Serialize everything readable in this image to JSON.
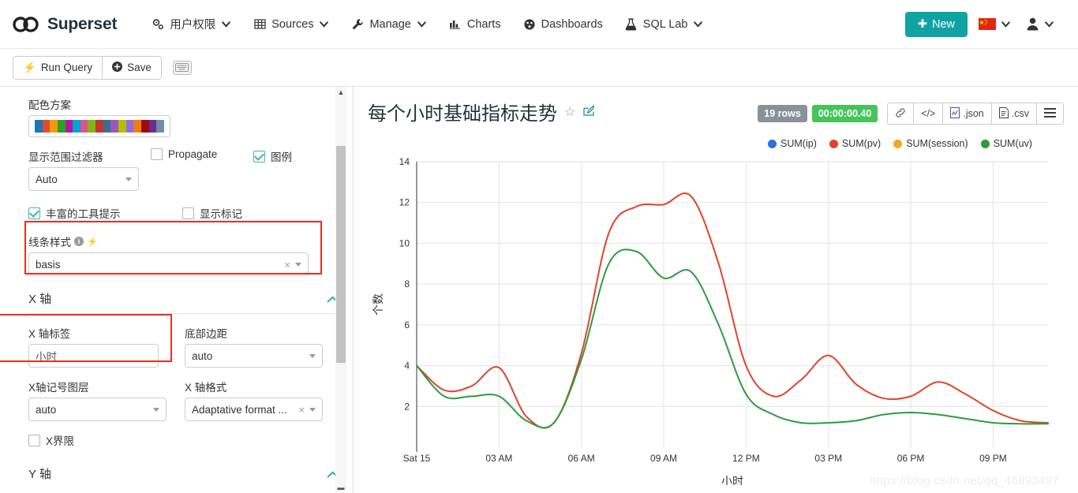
{
  "navbar": {
    "brand": "Superset",
    "items": [
      {
        "label": "用户权限",
        "icon": "gears-icon",
        "caret": true
      },
      {
        "label": "Sources",
        "icon": "table-icon",
        "caret": true
      },
      {
        "label": "Manage",
        "icon": "wrench-icon",
        "caret": true
      },
      {
        "label": "Charts",
        "icon": "bar-chart-icon",
        "caret": false
      },
      {
        "label": "Dashboards",
        "icon": "dashboard-icon",
        "caret": false
      },
      {
        "label": "SQL Lab",
        "icon": "flask-icon",
        "caret": true
      }
    ],
    "new_button": "New",
    "language_icon": "china-flag-icon",
    "user_icon": "user-icon"
  },
  "toolbar": {
    "run_query": "Run Query",
    "save": "Save",
    "keyboard_icon": "keyboard-icon"
  },
  "panel": {
    "color_scheme_label": "配色方案",
    "color_scheme_swatches": [
      "#1f77b4",
      "#d94e34",
      "#f59b00",
      "#2ca02c",
      "#b417a3",
      "#00a4cc",
      "#e0518f",
      "#7fb718",
      "#c23531",
      "#3b6e8f",
      "#9b59b6",
      "#b5bd00",
      "#8e6fe0",
      "#f07c16",
      "#9e0b0f",
      "#6b2c91",
      "#6d8fa6"
    ],
    "range_filter_label": "显示范围过滤器",
    "range_filter_value": "Auto",
    "propagate_label": "Propagate",
    "propagate_checked": false,
    "legend_label": "图例",
    "legend_checked": true,
    "rich_tooltip_label": "丰富的工具提示",
    "rich_tooltip_checked": true,
    "show_markers_label": "显示标记",
    "show_markers_checked": false,
    "line_style_label": "线条样式",
    "line_style_value": "basis",
    "x_axis_section": "X 轴",
    "x_axis_label_label": "X 轴标签",
    "x_axis_label_value": "小时",
    "bottom_margin_label": "底部边距",
    "bottom_margin_value": "auto",
    "x_ticks_layout_label": "X轴记号图层",
    "x_ticks_layout_value": "auto",
    "x_axis_format_label": "X 轴格式",
    "x_axis_format_value": "Adaptative format ...",
    "x_bounds_label": "X界限",
    "x_bounds_checked": false,
    "y_axis_section": "Y 轴"
  },
  "chart_header": {
    "title": "每个小时基础指标走势",
    "star_icon": "star-icon",
    "edit_icon": "edit-icon",
    "rows_badge": "19 rows",
    "time_badge": "00:00:00.40",
    "actions": [
      {
        "label": "",
        "icon": "link-icon"
      },
      {
        "label": "",
        "icon": "code-icon"
      },
      {
        "label": ".json",
        "icon": "json-file-icon"
      },
      {
        "label": ".csv",
        "icon": "csv-file-icon"
      },
      {
        "label": "",
        "icon": "hamburger-menu-icon"
      }
    ]
  },
  "watermark": "https://blog.csdn.net/qq_46893497",
  "chart_data": {
    "type": "line",
    "title": "每个小时基础指标走势",
    "xlabel": "小时",
    "ylabel": "个数",
    "grid": true,
    "legend_position": "top-right",
    "interpolation": "basis",
    "xtick_labels": [
      "Sat 15",
      "03 AM",
      "06 AM",
      "09 AM",
      "12 PM",
      "03 PM",
      "06 PM",
      "09 PM"
    ],
    "ytick_labels": [
      "2",
      "4",
      "6",
      "8",
      "10",
      "12",
      "14"
    ],
    "ylim": [
      0,
      14
    ],
    "x": [
      "00:00",
      "01:00",
      "02:00",
      "03:00",
      "04:00",
      "05:00",
      "06:00",
      "07:00",
      "08:00",
      "09:00",
      "10:00",
      "11:00",
      "12:00",
      "13:00",
      "14:00",
      "15:00",
      "16:00",
      "17:00",
      "18:00",
      "19:00",
      "20:00",
      "21:00",
      "22:00",
      "23:00"
    ],
    "series": [
      {
        "name": "SUM(ip)",
        "color": "#2a6fdb",
        "values": []
      },
      {
        "name": "SUM(pv)",
        "color": "#e1432a",
        "values": [
          4.0,
          2.8,
          3.0,
          3.9,
          1.5,
          1.2,
          4.6,
          10.5,
          11.8,
          11.9,
          12.3,
          9.0,
          4.0,
          2.5,
          3.3,
          4.5,
          3.1,
          2.4,
          2.5,
          3.2,
          2.6,
          1.8,
          1.3,
          1.2
        ]
      },
      {
        "name": "SUM(session)",
        "color": "#f5a623",
        "values": []
      },
      {
        "name": "SUM(uv)",
        "color": "#2e9b3f",
        "values": [
          4.0,
          2.5,
          2.5,
          2.5,
          1.3,
          1.2,
          4.3,
          9.0,
          9.6,
          8.3,
          8.6,
          6.0,
          2.6,
          1.6,
          1.2,
          1.2,
          1.3,
          1.6,
          1.7,
          1.6,
          1.4,
          1.2,
          1.15,
          1.15
        ]
      }
    ]
  }
}
